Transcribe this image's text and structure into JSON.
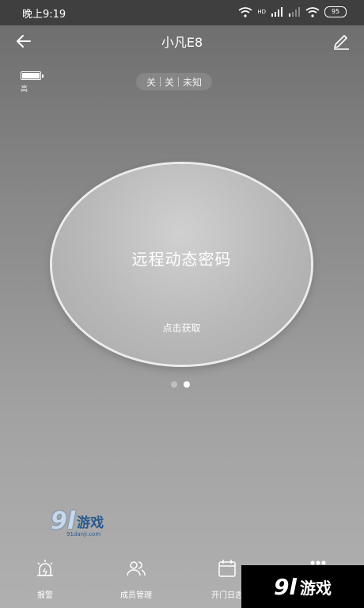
{
  "status_bar": {
    "time": "晚上9:19",
    "signal_label": "HD",
    "battery": "95"
  },
  "header": {
    "title": "小凡E8"
  },
  "device": {
    "battery_level_label": "高"
  },
  "status_chips": [
    "关",
    "关",
    "未知"
  ],
  "password_button": {
    "title": "远程动态密码",
    "subtitle": "点击获取"
  },
  "pager": {
    "count": 2,
    "active": 1
  },
  "watermark": {
    "brand_num": "9l",
    "brand_text": "游戏",
    "url": "91danji.com"
  },
  "tabs": [
    {
      "label": "报警",
      "icon": "alarm-icon"
    },
    {
      "label": "成员管理",
      "icon": "members-icon"
    },
    {
      "label": "开门日志",
      "icon": "calendar-icon"
    },
    {
      "label": "",
      "icon": "more-icon"
    }
  ],
  "banner": {
    "num": "9l",
    "text": "游戏"
  }
}
